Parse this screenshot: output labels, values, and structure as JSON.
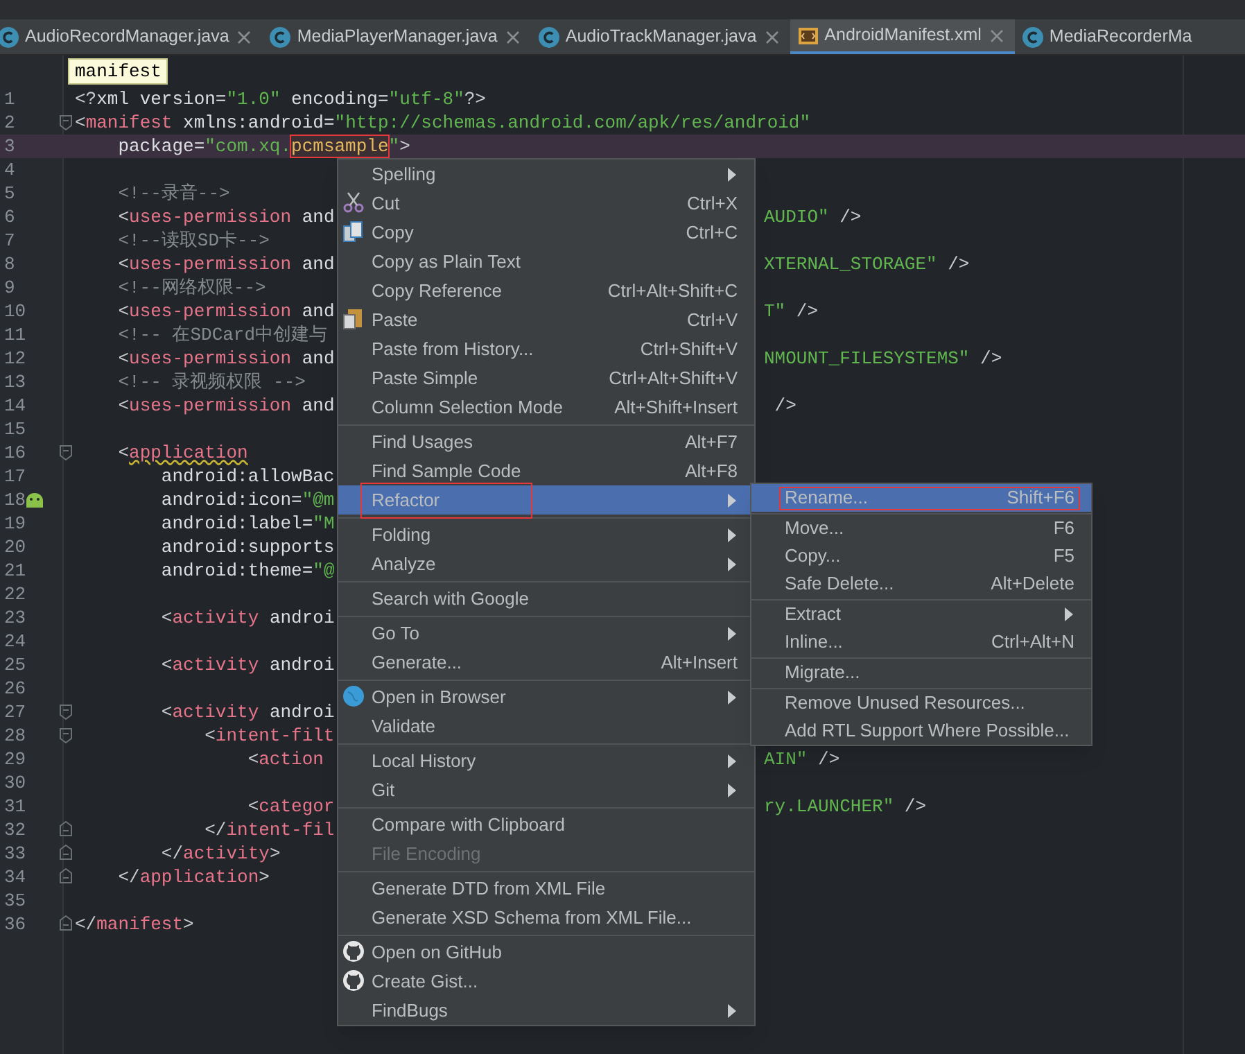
{
  "tabs": [
    {
      "label": "AudioRecordManager.java",
      "kind": "java",
      "selected": false,
      "closable": true
    },
    {
      "label": "MediaPlayerManager.java",
      "kind": "java",
      "selected": false,
      "closable": true
    },
    {
      "label": "AudioTrackManager.java",
      "kind": "java",
      "selected": false,
      "closable": true
    },
    {
      "label": "AndroidManifest.xml",
      "kind": "xml",
      "selected": true,
      "closable": true
    },
    {
      "label": "MediaRecorderMa",
      "kind": "java",
      "selected": false,
      "closable": false
    }
  ],
  "tooltip": "manifest",
  "editor": {
    "lines": [
      {
        "number": "1",
        "current": false,
        "tokens": [
          {
            "kind": "punct",
            "t": "<?"
          },
          {
            "kind": "attr",
            "t": "xml version="
          },
          {
            "kind": "str",
            "t": "\"1.0\""
          },
          {
            "kind": "attr",
            "t": " encoding="
          },
          {
            "kind": "str",
            "t": "\"utf-8\""
          },
          {
            "kind": "punct",
            "t": "?>"
          }
        ]
      },
      {
        "number": "2",
        "current": false,
        "kind": "fold_start",
        "tokens": [
          {
            "kind": "punct",
            "t": "<"
          },
          {
            "kind": "tag",
            "t": "manifest"
          },
          {
            "kind": "attr",
            "t": " xmlns:android="
          },
          {
            "kind": "str",
            "t": "\"http://schemas.android.com/apk/res/android\""
          }
        ]
      },
      {
        "number": "3",
        "current": true,
        "tokens": [
          {
            "kind": "attr",
            "t": "    package="
          },
          {
            "kind": "str",
            "t": "\"com.xq."
          },
          {
            "kind": "mark",
            "t": "pcmsample"
          },
          {
            "kind": "str",
            "t": "\""
          },
          {
            "kind": "punct",
            "t": ">"
          }
        ]
      },
      {
        "number": "4",
        "current": false
      },
      {
        "number": "5",
        "current": false,
        "tokens": [
          {
            "kind": "comment",
            "t": "    <!--录音-->"
          }
        ]
      },
      {
        "number": "6",
        "current": false,
        "tokens": [
          {
            "kind": "punct",
            "t": "    <"
          },
          {
            "kind": "tag",
            "t": "uses-permission"
          },
          {
            "kind": "attr",
            "t": " and"
          }
        ],
        "after": [
          {
            "kind": "str",
            "t": "AUDIO\""
          },
          {
            "kind": "punct",
            "t": " />"
          }
        ]
      },
      {
        "number": "7",
        "current": false,
        "tokens": [
          {
            "kind": "comment",
            "t": "    <!--读取SD卡-->"
          }
        ]
      },
      {
        "number": "8",
        "current": false,
        "tokens": [
          {
            "kind": "punct",
            "t": "    <"
          },
          {
            "kind": "tag",
            "t": "uses-permission"
          },
          {
            "kind": "attr",
            "t": " and"
          }
        ],
        "after": [
          {
            "kind": "str",
            "t": "XTERNAL_STORAGE\""
          },
          {
            "kind": "punct",
            "t": " />"
          }
        ]
      },
      {
        "number": "9",
        "current": false,
        "tokens": [
          {
            "kind": "comment",
            "t": "    <!--网络权限-->"
          }
        ]
      },
      {
        "number": "10",
        "current": false,
        "tokens": [
          {
            "kind": "punct",
            "t": "    <"
          },
          {
            "kind": "tag",
            "t": "uses-permission"
          },
          {
            "kind": "attr",
            "t": " and"
          }
        ],
        "after": [
          {
            "kind": "str",
            "t": "T\""
          },
          {
            "kind": "punct",
            "t": " />"
          }
        ]
      },
      {
        "number": "11",
        "current": false,
        "tokens": [
          {
            "kind": "comment",
            "t": "    <!-- 在SDCard中创建与"
          }
        ]
      },
      {
        "number": "12",
        "current": false,
        "tokens": [
          {
            "kind": "punct",
            "t": "    <"
          },
          {
            "kind": "tag",
            "t": "uses-permission"
          },
          {
            "kind": "attr",
            "t": " and"
          }
        ],
        "after": [
          {
            "kind": "str",
            "t": "NMOUNT_FILESYSTEMS\""
          },
          {
            "kind": "punct",
            "t": " />"
          }
        ]
      },
      {
        "number": "13",
        "current": false,
        "tokens": [
          {
            "kind": "comment",
            "t": "    <!-- 录视频权限 -->"
          }
        ]
      },
      {
        "number": "14",
        "current": false,
        "tokens": [
          {
            "kind": "punct",
            "t": "    <"
          },
          {
            "kind": "tag",
            "t": "uses-permission"
          },
          {
            "kind": "attr",
            "t": " and"
          }
        ],
        "after": [
          {
            "kind": "punct",
            "t": " />"
          }
        ]
      },
      {
        "number": "15",
        "current": false
      },
      {
        "number": "16",
        "current": false,
        "kind": "fold_start",
        "tokens": [
          {
            "kind": "punct",
            "t": "    <"
          },
          {
            "kind": "tag_warn",
            "t": "application"
          }
        ]
      },
      {
        "number": "17",
        "current": false,
        "tokens": [
          {
            "kind": "attr",
            "t": "        android:allowBac"
          }
        ]
      },
      {
        "number": "18",
        "current": false,
        "kind": "android_marker",
        "tokens": [
          {
            "kind": "attr",
            "t": "        android:icon="
          },
          {
            "kind": "str",
            "t": "\"@m"
          }
        ]
      },
      {
        "number": "19",
        "current": false,
        "tokens": [
          {
            "kind": "attr",
            "t": "        android:label="
          },
          {
            "kind": "str",
            "t": "\"M"
          }
        ]
      },
      {
        "number": "20",
        "current": false,
        "tokens": [
          {
            "kind": "attr",
            "t": "        android:supports"
          }
        ]
      },
      {
        "number": "21",
        "current": false,
        "tokens": [
          {
            "kind": "attr",
            "t": "        android:theme="
          },
          {
            "kind": "str",
            "t": "\"@"
          }
        ]
      },
      {
        "number": "22",
        "current": false
      },
      {
        "number": "23",
        "current": false,
        "tokens": [
          {
            "kind": "punct",
            "t": "        <"
          },
          {
            "kind": "tag",
            "t": "activity"
          },
          {
            "kind": "attr",
            "t": " androi"
          }
        ]
      },
      {
        "number": "24",
        "current": false
      },
      {
        "number": "25",
        "current": false,
        "tokens": [
          {
            "kind": "punct",
            "t": "        <"
          },
          {
            "kind": "tag",
            "t": "activity"
          },
          {
            "kind": "attr",
            "t": " androi"
          }
        ]
      },
      {
        "number": "26",
        "current": false
      },
      {
        "number": "27",
        "current": false,
        "kind": "fold_start",
        "tokens": [
          {
            "kind": "punct",
            "t": "        <"
          },
          {
            "kind": "tag",
            "t": "activity"
          },
          {
            "kind": "attr",
            "t": " androi"
          }
        ]
      },
      {
        "number": "28",
        "current": false,
        "kind": "fold_start",
        "tokens": [
          {
            "kind": "punct",
            "t": "            <"
          },
          {
            "kind": "tag",
            "t": "intent-filt"
          }
        ]
      },
      {
        "number": "29",
        "current": false,
        "tokens": [
          {
            "kind": "punct",
            "t": "                <"
          },
          {
            "kind": "tag",
            "t": "action"
          }
        ],
        "after": [
          {
            "kind": "str",
            "t": "AIN\""
          },
          {
            "kind": "punct",
            "t": " />"
          }
        ]
      },
      {
        "number": "30",
        "current": false
      },
      {
        "number": "31",
        "current": false,
        "tokens": [
          {
            "kind": "punct",
            "t": "                <"
          },
          {
            "kind": "tag",
            "t": "categor"
          }
        ],
        "after": [
          {
            "kind": "str",
            "t": "ry.LAUNCHER\""
          },
          {
            "kind": "punct",
            "t": " />"
          }
        ]
      },
      {
        "number": "32",
        "current": false,
        "kind": "fold_end",
        "tokens": [
          {
            "kind": "punct",
            "t": "            </"
          },
          {
            "kind": "tag",
            "t": "intent-fil"
          }
        ]
      },
      {
        "number": "33",
        "current": false,
        "kind": "fold_end",
        "tokens": [
          {
            "kind": "punct",
            "t": "        </"
          },
          {
            "kind": "tag",
            "t": "activity"
          },
          {
            "kind": "punct",
            "t": ">"
          }
        ]
      },
      {
        "number": "34",
        "current": false,
        "kind": "fold_end",
        "tokens": [
          {
            "kind": "punct",
            "t": "    </"
          },
          {
            "kind": "tag",
            "t": "application"
          },
          {
            "kind": "punct",
            "t": ">"
          }
        ]
      },
      {
        "number": "35",
        "current": false
      },
      {
        "number": "36",
        "current": false,
        "kind": "fold_end",
        "tokens": [
          {
            "kind": "punct",
            "t": "</"
          },
          {
            "kind": "tag",
            "t": "manifest"
          },
          {
            "kind": "punct",
            "t": ">"
          }
        ]
      }
    ]
  },
  "context_menu": {
    "groups": [
      {
        "items": [
          {
            "label": "Spelling",
            "submenu": true,
            "selected": false,
            "disabled": false,
            "marked": false
          },
          {
            "label": "Cut",
            "shortcut": "Ctrl+X",
            "kind": "cut",
            "submenu": false,
            "selected": false,
            "disabled": false,
            "marked": false
          },
          {
            "label": "Copy",
            "shortcut": "Ctrl+C",
            "kind": "copy",
            "submenu": false,
            "selected": false,
            "disabled": false,
            "marked": false
          },
          {
            "label": "Copy as Plain Text",
            "submenu": false,
            "selected": false,
            "disabled": false,
            "marked": false
          },
          {
            "label": "Copy Reference",
            "shortcut": "Ctrl+Alt+Shift+C",
            "submenu": false,
            "selected": false,
            "disabled": false,
            "marked": false
          },
          {
            "label": "Paste",
            "shortcut": "Ctrl+V",
            "kind": "paste",
            "submenu": false,
            "selected": false,
            "disabled": false,
            "marked": false
          },
          {
            "label": "Paste from History...",
            "shortcut": "Ctrl+Shift+V",
            "submenu": false,
            "selected": false,
            "disabled": false,
            "marked": false
          },
          {
            "label": "Paste Simple",
            "shortcut": "Ctrl+Alt+Shift+V",
            "submenu": false,
            "selected": false,
            "disabled": false,
            "marked": false
          },
          {
            "label": "Column Selection Mode",
            "shortcut": "Alt+Shift+Insert",
            "submenu": false,
            "selected": false,
            "disabled": false,
            "marked": false
          }
        ]
      },
      {
        "items": [
          {
            "label": "Find Usages",
            "shortcut": "Alt+F7",
            "submenu": false,
            "selected": false,
            "disabled": false,
            "marked": false
          },
          {
            "label": "Find Sample Code",
            "shortcut": "Alt+F8",
            "submenu": false,
            "selected": false,
            "disabled": false,
            "marked": false
          },
          {
            "label": "Refactor",
            "submenu": true,
            "selected": true,
            "disabled": false,
            "marked": true
          }
        ]
      },
      {
        "items": [
          {
            "label": "Folding",
            "submenu": true,
            "selected": false,
            "disabled": false,
            "marked": false
          },
          {
            "label": "Analyze",
            "submenu": true,
            "selected": false,
            "disabled": false,
            "marked": false
          }
        ]
      },
      {
        "items": [
          {
            "label": "Search with Google",
            "submenu": false,
            "selected": false,
            "disabled": false,
            "marked": false
          }
        ]
      },
      {
        "items": [
          {
            "label": "Go To",
            "submenu": true,
            "selected": false,
            "disabled": false,
            "marked": false
          },
          {
            "label": "Generate...",
            "shortcut": "Alt+Insert",
            "submenu": false,
            "selected": false,
            "disabled": false,
            "marked": false
          }
        ]
      },
      {
        "items": [
          {
            "label": "Open in Browser",
            "kind": "globe",
            "submenu": true,
            "selected": false,
            "disabled": false,
            "marked": false
          },
          {
            "label": "Validate",
            "submenu": false,
            "selected": false,
            "disabled": false,
            "marked": false
          }
        ]
      },
      {
        "items": [
          {
            "label": "Local History",
            "submenu": true,
            "selected": false,
            "disabled": false,
            "marked": false
          },
          {
            "label": "Git",
            "submenu": true,
            "selected": false,
            "disabled": false,
            "marked": false
          }
        ]
      },
      {
        "items": [
          {
            "label": "Compare with Clipboard",
            "submenu": false,
            "selected": false,
            "disabled": false,
            "marked": false
          },
          {
            "label": "File Encoding",
            "submenu": false,
            "selected": false,
            "disabled": true,
            "marked": false
          }
        ]
      },
      {
        "items": [
          {
            "label": "Generate DTD from XML File",
            "submenu": false,
            "selected": false,
            "disabled": false,
            "marked": false
          },
          {
            "label": "Generate XSD Schema from XML File...",
            "submenu": false,
            "selected": false,
            "disabled": false,
            "marked": false
          }
        ]
      },
      {
        "items": [
          {
            "label": "Open on GitHub",
            "kind": "github",
            "submenu": false,
            "selected": false,
            "disabled": false,
            "marked": false
          },
          {
            "label": "Create Gist...",
            "kind": "github",
            "submenu": false,
            "selected": false,
            "disabled": false,
            "marked": false
          },
          {
            "label": "FindBugs",
            "submenu": true,
            "selected": false,
            "disabled": false,
            "marked": false
          }
        ]
      }
    ]
  },
  "refactor_submenu": {
    "groups": [
      {
        "items": [
          {
            "label": "Rename...",
            "shortcut": "Shift+F6",
            "submenu": false,
            "selected": true,
            "disabled": false,
            "marked": true
          }
        ]
      },
      {
        "items": [
          {
            "label": "Move...",
            "shortcut": "F6",
            "submenu": false,
            "selected": false,
            "disabled": false,
            "marked": false
          },
          {
            "label": "Copy...",
            "shortcut": "F5",
            "submenu": false,
            "selected": false,
            "disabled": false,
            "marked": false
          },
          {
            "label": "Safe Delete...",
            "shortcut": "Alt+Delete",
            "submenu": false,
            "selected": false,
            "disabled": false,
            "marked": false
          }
        ]
      },
      {
        "items": [
          {
            "label": "Extract",
            "submenu": true,
            "selected": false,
            "disabled": false,
            "marked": false
          },
          {
            "label": "Inline...",
            "shortcut": "Ctrl+Alt+N",
            "submenu": false,
            "selected": false,
            "disabled": false,
            "marked": false
          }
        ]
      },
      {
        "items": [
          {
            "label": "Migrate...",
            "submenu": false,
            "selected": false,
            "disabled": false,
            "marked": false
          }
        ]
      },
      {
        "items": [
          {
            "label": "Remove Unused Resources...",
            "submenu": false,
            "selected": false,
            "disabled": false,
            "marked": false
          },
          {
            "label": "Add RTL Support Where Possible...",
            "submenu": false,
            "selected": false,
            "disabled": false,
            "marked": false
          }
        ]
      }
    ]
  }
}
